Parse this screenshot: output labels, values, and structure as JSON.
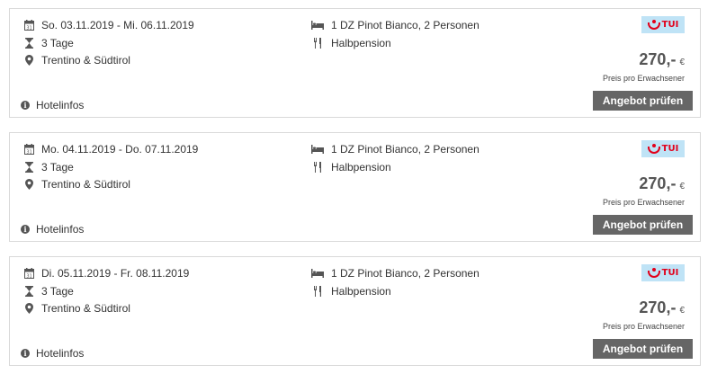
{
  "offers": [
    {
      "dates": "So. 03.11.2019 - Mi. 06.11.2019",
      "duration": "3 Tage",
      "region": "Trentino & Südtirol",
      "room": "1 DZ Pinot Bianco, 2 Personen",
      "board": "Halbpension",
      "hotelinfo": "Hotelinfos",
      "provider": "TUI",
      "price": "270,-",
      "currency": "€",
      "price_note": "Preis pro Erwachsener",
      "cta": "Angebot prüfen"
    },
    {
      "dates": "Mo. 04.11.2019 - Do. 07.11.2019",
      "duration": "3 Tage",
      "region": "Trentino & Südtirol",
      "room": "1 DZ Pinot Bianco, 2 Personen",
      "board": "Halbpension",
      "hotelinfo": "Hotelinfos",
      "provider": "TUI",
      "price": "270,-",
      "currency": "€",
      "price_note": "Preis pro Erwachsener",
      "cta": "Angebot prüfen"
    },
    {
      "dates": "Di. 05.11.2019 - Fr. 08.11.2019",
      "duration": "3 Tage",
      "region": "Trentino & Südtirol",
      "room": "1 DZ Pinot Bianco, 2 Personen",
      "board": "Halbpension",
      "hotelinfo": "Hotelinfos",
      "provider": "TUI",
      "price": "270,-",
      "currency": "€",
      "price_note": "Preis pro Erwachsener",
      "cta": "Angebot prüfen"
    }
  ],
  "icons": {
    "date": "calendar-icon",
    "duration": "hourglass-icon",
    "region": "location-pin-icon",
    "room": "bed-icon",
    "board": "cutlery-icon",
    "info": "info-icon"
  },
  "colors": {
    "button_bg": "#666666",
    "border": "#d9d9d9",
    "brand_red": "#e2001a",
    "brand_blue": "#bfe3f6"
  }
}
